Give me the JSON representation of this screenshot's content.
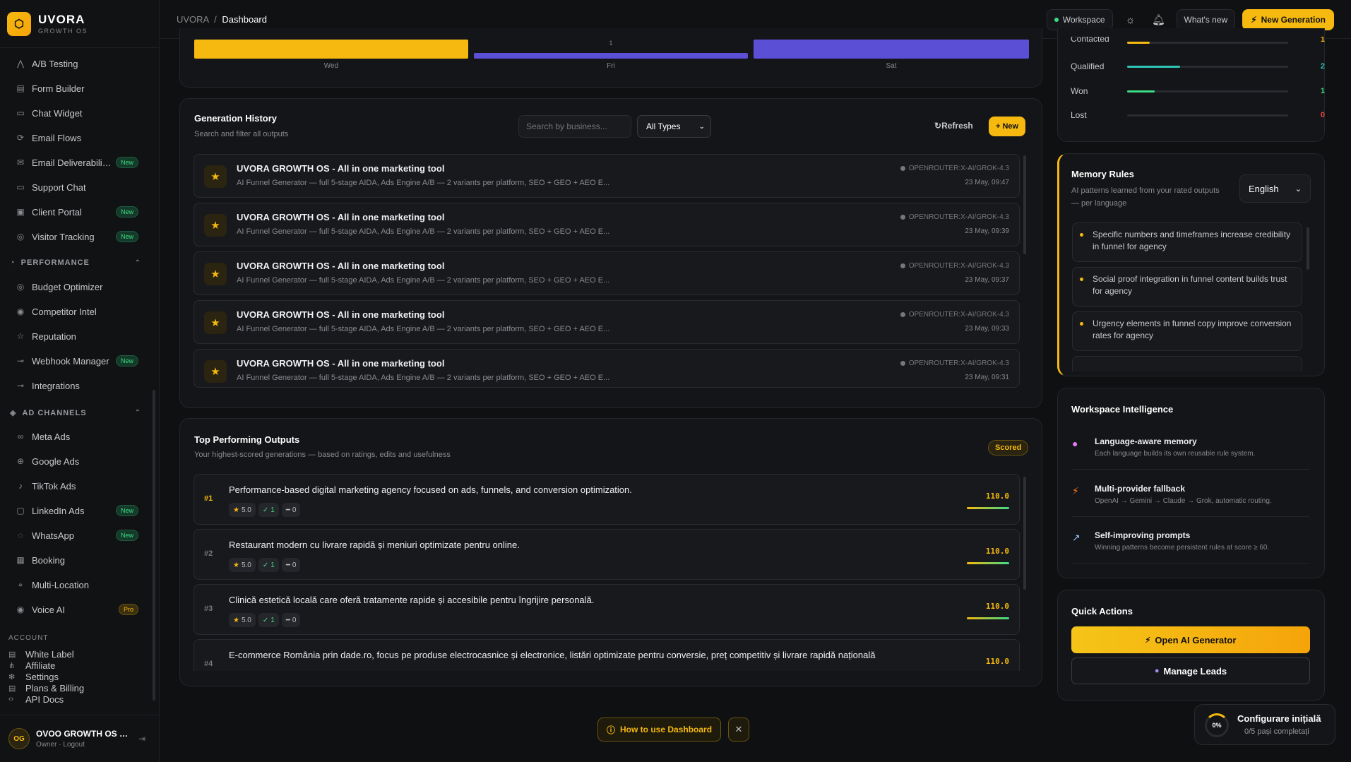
{
  "app": {
    "name": "UVORA",
    "tagline": "GROWTH OS"
  },
  "topbar": {
    "breadcrumb_root": "UVORA",
    "breadcrumb_sep": "/",
    "breadcrumb_current": "Dashboard",
    "workspace_label": "Workspace",
    "whats_new": "What's new",
    "new_generation": "New Generation"
  },
  "sidebar": {
    "items": [
      {
        "label": "A/B Testing",
        "icon": "ab-test-icon",
        "badge": ""
      },
      {
        "label": "Form Builder",
        "icon": "form-icon",
        "badge": ""
      },
      {
        "label": "Chat Widget",
        "icon": "chat-icon",
        "badge": ""
      },
      {
        "label": "Email Flows",
        "icon": "flow-icon",
        "badge": ""
      },
      {
        "label": "Email Deliverabili…",
        "icon": "mail-icon",
        "badge": "New"
      },
      {
        "label": "Support Chat",
        "icon": "support-icon",
        "badge": ""
      },
      {
        "label": "Client Portal",
        "icon": "portal-icon",
        "badge": "New"
      },
      {
        "label": "Visitor Tracking",
        "icon": "tracking-icon",
        "badge": "New"
      }
    ],
    "performance_header": "PERFORMANCE",
    "performance_items": [
      {
        "label": "Budget Optimizer",
        "badge": ""
      },
      {
        "label": "Competitor Intel",
        "badge": ""
      },
      {
        "label": "Reputation",
        "badge": ""
      },
      {
        "label": "Webhook Manager",
        "badge": "New"
      },
      {
        "label": "Integrations",
        "badge": ""
      }
    ],
    "ad_channels_header": "AD CHANNELS",
    "ad_items": [
      {
        "label": "Meta Ads",
        "badge": ""
      },
      {
        "label": "Google Ads",
        "badge": ""
      },
      {
        "label": "TikTok Ads",
        "badge": ""
      },
      {
        "label": "LinkedIn Ads",
        "badge": "New"
      },
      {
        "label": "WhatsApp",
        "badge": "New"
      },
      {
        "label": "Booking",
        "badge": ""
      },
      {
        "label": "Multi-Location",
        "badge": ""
      },
      {
        "label": "Voice AI",
        "badge": "Pro"
      }
    ],
    "account_header": "ACCOUNT",
    "account_items": [
      "White Label",
      "Affiliate",
      "Settings",
      "Plans & Billing",
      "API Docs"
    ],
    "user": {
      "initials": "OG",
      "name": "OVOO GROWTH OS …",
      "role": "Owner · Logout"
    }
  },
  "weekly_chart": {
    "days": [
      "Wed",
      "Fri",
      "Sat"
    ],
    "value_label_fri": "1"
  },
  "history": {
    "title": "Generation History",
    "subtitle": "Search and filter all outputs",
    "search_placeholder": "Search by business...",
    "type_filter": "All Types",
    "refresh": "Refresh",
    "new": "+ New",
    "rows": [
      {
        "title": "UVORA GROWTH OS - All in one marketing tool",
        "desc": "AI Funnel Generator — full 5-stage AIDA, Ads Engine A/B — 2 variants per platform, SEO + GEO + AEO E...",
        "model": "OPENROUTER:X-AI/GROK-4.3",
        "date": "23 May, 09:47"
      },
      {
        "title": "UVORA GROWTH OS - All in one marketing tool",
        "desc": "AI Funnel Generator — full 5-stage AIDA, Ads Engine A/B — 2 variants per platform, SEO + GEO + AEO E...",
        "model": "OPENROUTER:X-AI/GROK-4.3",
        "date": "23 May, 09:39"
      },
      {
        "title": "UVORA GROWTH OS - All in one marketing tool",
        "desc": "AI Funnel Generator — full 5-stage AIDA, Ads Engine A/B — 2 variants per platform, SEO + GEO + AEO E...",
        "model": "OPENROUTER:X-AI/GROK-4.3",
        "date": "23 May, 09:37"
      },
      {
        "title": "UVORA GROWTH OS - All in one marketing tool",
        "desc": "AI Funnel Generator — full 5-stage AIDA, Ads Engine A/B — 2 variants per platform, SEO + GEO + AEO E...",
        "model": "OPENROUTER:X-AI/GROK-4.3",
        "date": "23 May, 09:33"
      },
      {
        "title": "UVORA GROWTH OS - All in one marketing tool",
        "desc": "AI Funnel Generator — full 5-stage AIDA, Ads Engine A/B — 2 variants per platform, SEO + GEO + AEO E...",
        "model": "OPENROUTER:X-AI/GROK-4.3",
        "date": "23 May, 09:31"
      }
    ]
  },
  "top_outputs": {
    "title": "Top Performing Outputs",
    "subtitle": "Your highest-scored generations — based on ratings, edits and usefulness",
    "badge": "Scored",
    "rows": [
      {
        "rank": "#1",
        "title": "Performance-based digital marketing agency focused on ads, funnels, and conversion optimization.",
        "rating": "5.0",
        "approvals": "1",
        "edits": "0",
        "score": "110.0"
      },
      {
        "rank": "#2",
        "title": "Restaurant modern cu livrare rapidă și meniuri optimizate pentru online.",
        "rating": "5.0",
        "approvals": "1",
        "edits": "0",
        "score": "110.0"
      },
      {
        "rank": "#3",
        "title": "Clinică estetică locală care oferă tratamente rapide și accesibile pentru îngrijire personală.",
        "rating": "5.0",
        "approvals": "1",
        "edits": "0",
        "score": "110.0"
      },
      {
        "rank": "#4",
        "title": "E-commerce România prin dade.ro, focus pe produse electrocasnice și electronice, listări optimizate pentru conversie, preț competitiv și livrare rapidă națională",
        "rating": "",
        "approvals": "",
        "edits": "",
        "score": "110.0"
      }
    ]
  },
  "pipeline": {
    "rows": [
      {
        "label": "Contacted",
        "value": "1",
        "fill": 0.14,
        "color": "#f5b90f"
      },
      {
        "label": "Qualified",
        "value": "2",
        "fill": 0.33,
        "color": "#2ec4b6"
      },
      {
        "label": "Won",
        "value": "1",
        "fill": 0.17,
        "color": "#3ddc84"
      },
      {
        "label": "Lost",
        "value": "0",
        "fill": 0,
        "color": "#ef4444"
      }
    ]
  },
  "memory_rules": {
    "title": "Memory Rules",
    "subtitle": "AI patterns learned from your rated outputs — per language",
    "language": "English",
    "rules": [
      "Specific numbers and timeframes increase credibility in funnel for agency",
      "Social proof integration in funnel content builds trust for agency",
      "Urgency elements in funnel copy improve conversion rates for agency"
    ]
  },
  "workspace_intel": {
    "title": "Workspace Intelligence",
    "items": [
      {
        "title": "Language-aware memory",
        "desc": "Each language builds its own reusable rule system.",
        "icon": "brain-icon"
      },
      {
        "title": "Multi-provider fallback",
        "desc": "OpenAI → Gemini → Claude → Grok, automatic routing.",
        "icon": "bolt-icon"
      },
      {
        "title": "Self-improving prompts",
        "desc": "Winning patterns become persistent rules at score ≥ 60.",
        "icon": "chart-icon"
      }
    ]
  },
  "quick_actions": {
    "title": "Quick Actions",
    "open_generator": "Open AI Generator",
    "manage_leads": "Manage Leads"
  },
  "help": {
    "label": "How to use Dashboard"
  },
  "setup": {
    "percent": "0%",
    "title": "Configurare inițială",
    "progress": "0/5 pași completați"
  },
  "colors": {
    "accent": "#f5b90f",
    "purple": "#5b4fd6",
    "green": "#3ddc84"
  }
}
